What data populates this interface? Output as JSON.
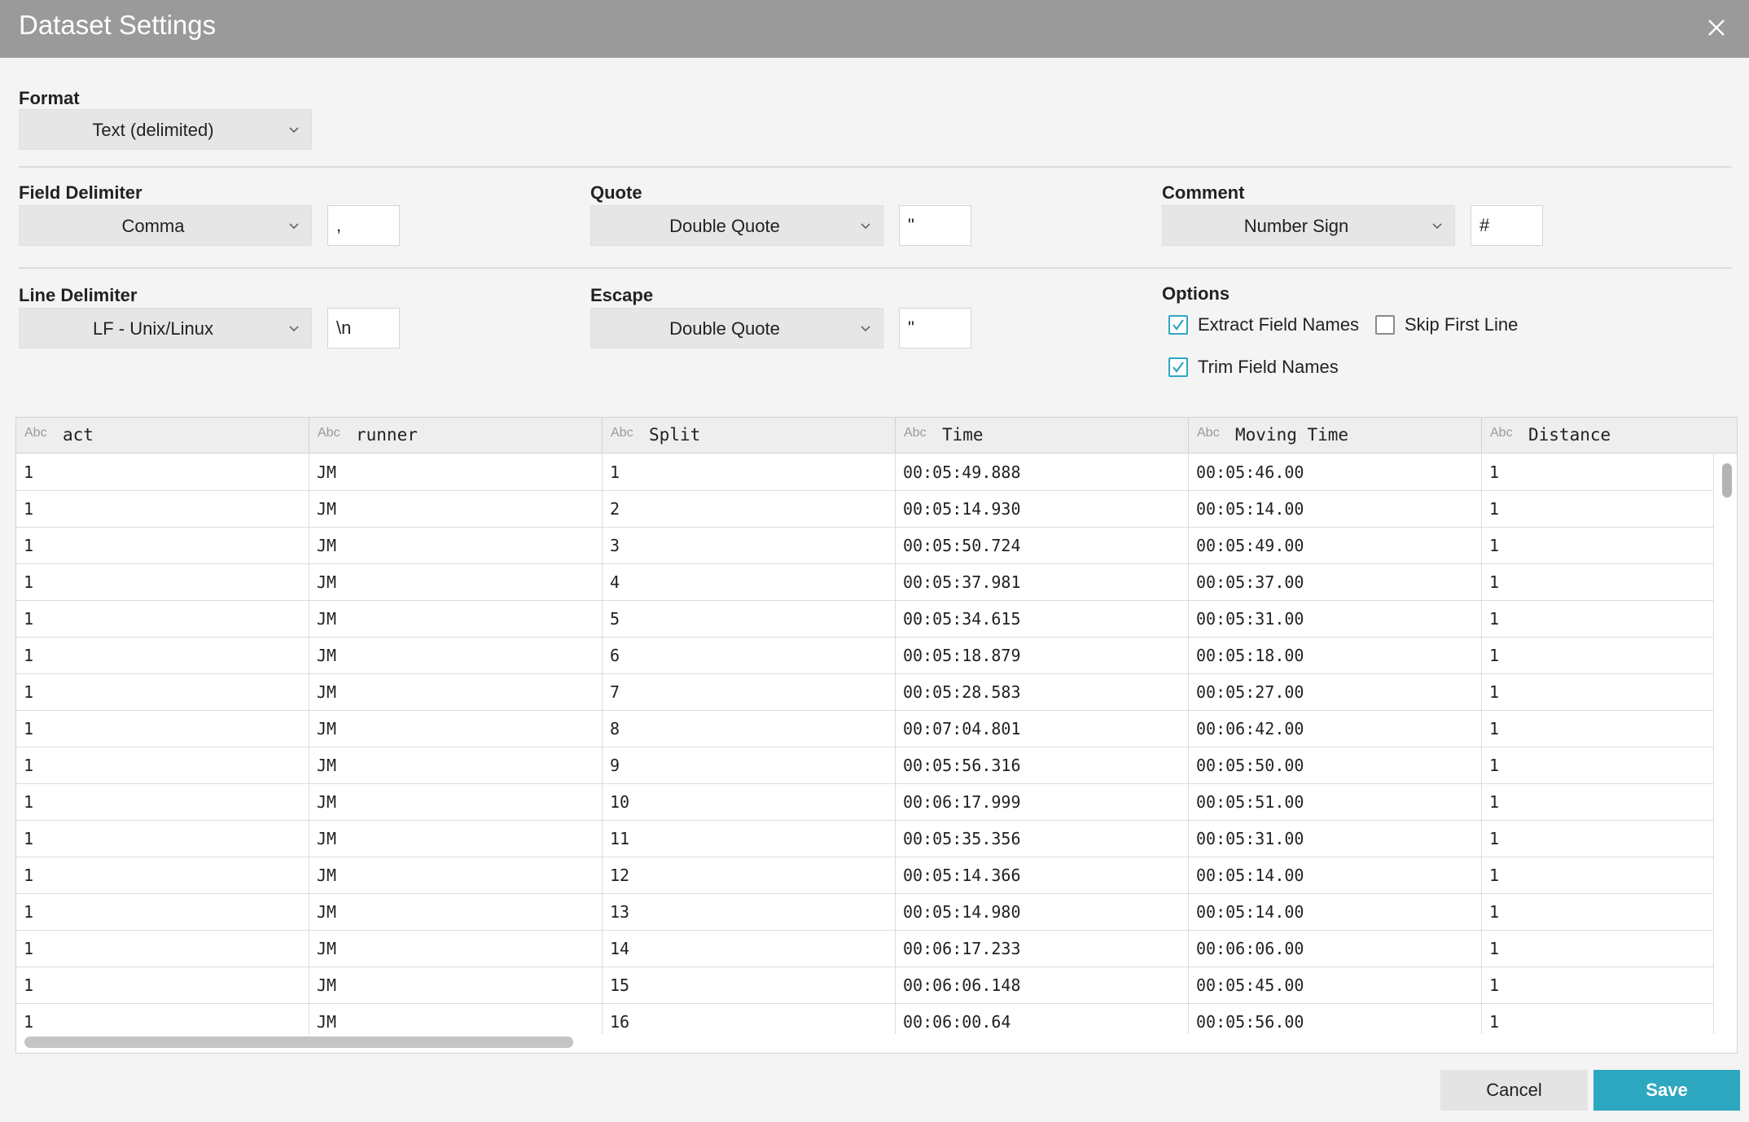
{
  "dialog": {
    "title": "Dataset Settings"
  },
  "format": {
    "label": "Format",
    "value": "Text (delimited)"
  },
  "field_delimiter": {
    "label": "Field Delimiter",
    "value": "Comma",
    "char": ","
  },
  "quote": {
    "label": "Quote",
    "value": "Double Quote",
    "char": "\""
  },
  "comment": {
    "label": "Comment",
    "value": "Number Sign",
    "char": "#"
  },
  "line_delimiter": {
    "label": "Line Delimiter",
    "value": "LF - Unix/Linux",
    "char": "\\n"
  },
  "escape": {
    "label": "Escape",
    "value": "Double Quote",
    "char": "\""
  },
  "options": {
    "label": "Options",
    "extract_field_names": {
      "label": "Extract Field Names",
      "checked": true
    },
    "skip_first_line": {
      "label": "Skip First Line",
      "checked": false
    },
    "trim_field_names": {
      "label": "Trim Field Names",
      "checked": true
    }
  },
  "grid": {
    "type_icon": "Abc",
    "columns": [
      "act",
      "runner",
      "Split",
      "Time",
      "Moving Time",
      "Distance"
    ],
    "rows": [
      [
        "1",
        "JM",
        "1",
        "00:05:49.888",
        "00:05:46.00",
        "1"
      ],
      [
        "1",
        "JM",
        "2",
        "00:05:14.930",
        "00:05:14.00",
        "1"
      ],
      [
        "1",
        "JM",
        "3",
        "00:05:50.724",
        "00:05:49.00",
        "1"
      ],
      [
        "1",
        "JM",
        "4",
        "00:05:37.981",
        "00:05:37.00",
        "1"
      ],
      [
        "1",
        "JM",
        "5",
        "00:05:34.615",
        "00:05:31.00",
        "1"
      ],
      [
        "1",
        "JM",
        "6",
        "00:05:18.879",
        "00:05:18.00",
        "1"
      ],
      [
        "1",
        "JM",
        "7",
        "00:05:28.583",
        "00:05:27.00",
        "1"
      ],
      [
        "1",
        "JM",
        "8",
        "00:07:04.801",
        "00:06:42.00",
        "1"
      ],
      [
        "1",
        "JM",
        "9",
        "00:05:56.316",
        "00:05:50.00",
        "1"
      ],
      [
        "1",
        "JM",
        "10",
        "00:06:17.999",
        "00:05:51.00",
        "1"
      ],
      [
        "1",
        "JM",
        "11",
        "00:05:35.356",
        "00:05:31.00",
        "1"
      ],
      [
        "1",
        "JM",
        "12",
        "00:05:14.366",
        "00:05:14.00",
        "1"
      ],
      [
        "1",
        "JM",
        "13",
        "00:05:14.980",
        "00:05:14.00",
        "1"
      ],
      [
        "1",
        "JM",
        "14",
        "00:06:17.233",
        "00:06:06.00",
        "1"
      ],
      [
        "1",
        "JM",
        "15",
        "00:06:06.148",
        "00:05:45.00",
        "1"
      ],
      [
        "1",
        "JM",
        "16",
        "00:06:00.64",
        "00:05:56.00",
        "1"
      ]
    ]
  },
  "footer": {
    "cancel_label": "Cancel",
    "save_label": "Save"
  },
  "colors": {
    "header_bg": "#9a9a9a",
    "accent": "#2ea7c0",
    "panel_bg": "#f4f4f4"
  }
}
